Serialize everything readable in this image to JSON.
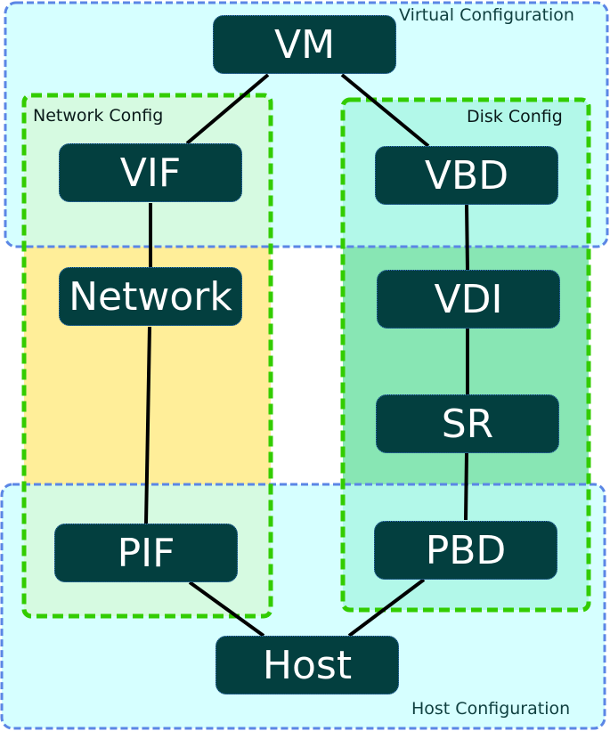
{
  "diagram": {
    "title": "",
    "groups": {
      "virtual": {
        "label": "Virtual Configuration",
        "fill": "#d5ffff",
        "stroke": "#5b86e5"
      },
      "host": {
        "label": "Host Configuration",
        "fill": "#d5ffff",
        "stroke": "#5b86e5"
      },
      "network": {
        "label": "Network Config",
        "fill": "#ffee99",
        "stroke": "#33cc00"
      },
      "disk": {
        "label": "Disk Config",
        "fill": "#88e6b4",
        "stroke": "#33cc00"
      }
    },
    "nodes": {
      "vm": "VM",
      "vif": "VIF",
      "network": "Network",
      "pif": "PIF",
      "vbd": "VBD",
      "vdi": "VDI",
      "sr": "SR",
      "pbd": "PBD",
      "host": "Host"
    },
    "edges": [
      {
        "from": "VM",
        "to": "VIF"
      },
      {
        "from": "VM",
        "to": "VBD"
      },
      {
        "from": "VIF",
        "to": "Network"
      },
      {
        "from": "Network",
        "to": "PIF"
      },
      {
        "from": "PIF",
        "to": "Host"
      },
      {
        "from": "VBD",
        "to": "VDI"
      },
      {
        "from": "VDI",
        "to": "SR"
      },
      {
        "from": "SR",
        "to": "PBD"
      },
      {
        "from": "PBD",
        "to": "Host"
      }
    ],
    "colors": {
      "node_fill": "#033f3f",
      "node_text": "#ffffff",
      "edge": "#000000"
    }
  }
}
